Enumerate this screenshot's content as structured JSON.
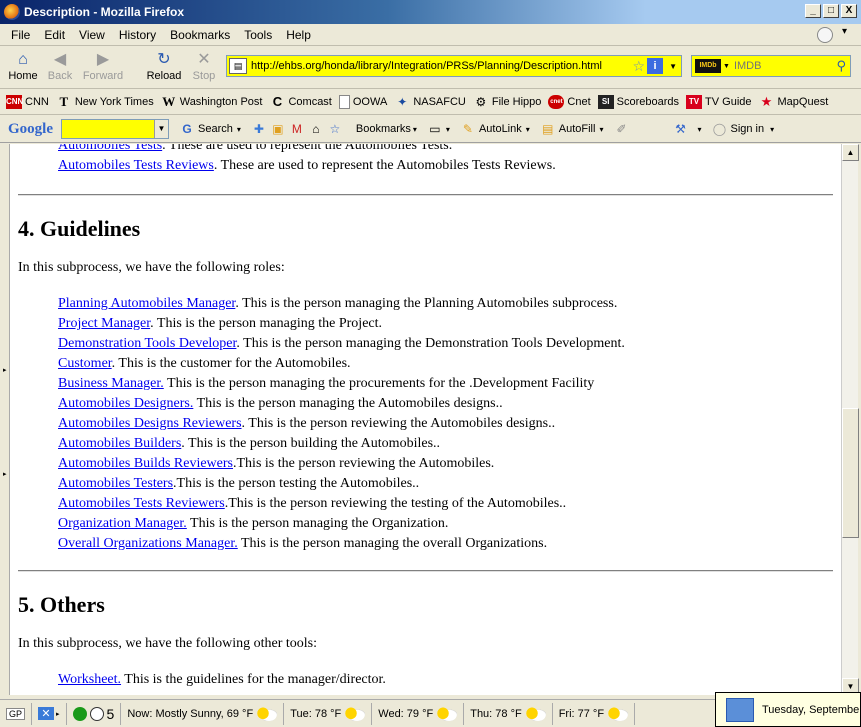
{
  "window": {
    "title": "Description - Mozilla Firefox",
    "btn_min": "_",
    "btn_max": "□",
    "btn_close": "X"
  },
  "menu": [
    "File",
    "Edit",
    "View",
    "History",
    "Bookmarks",
    "Tools",
    "Help"
  ],
  "nav": {
    "home": "Home",
    "back": "Back",
    "forward": "Forward",
    "reload": "Reload",
    "stop": "Stop",
    "url": "http://ehbs.org/honda/library/Integration/PRSs/Planning/Description.html",
    "search_engine": "IMDb",
    "search_placeholder": "IMDB"
  },
  "bookmarks": [
    "CNN",
    "New York Times",
    "Washington Post",
    "Comcast",
    "OOWA",
    "NASAFCU",
    "File Hippo",
    "Cnet",
    "Scoreboards",
    "TV Guide",
    "MapQuest"
  ],
  "google_toolbar": {
    "logo": "Google",
    "search": "Search",
    "bookmarks": "Bookmarks",
    "autolink": "AutoLink",
    "autofill": "AutoFill",
    "signin": "Sign in"
  },
  "content": {
    "top_lines": [
      {
        "link": "Automobiles Tests",
        "text": ". These are used to represent the Automobiles Tests."
      },
      {
        "link": "Automobiles Tests Reviews",
        "text": ". These are used to represent the Automobiles Tests Reviews."
      }
    ],
    "section4": {
      "heading": "4. Guidelines",
      "intro": "In this subprocess, we have the following roles:",
      "roles": [
        {
          "link": "Planning Automobiles Manager",
          "text": ". This is the person managing the Planning Automobiles subprocess."
        },
        {
          "link": "Project Manager",
          "text": ". This is the person managing the Project."
        },
        {
          "link": "Demonstration Tools Developer",
          "text": ". This is the person managing the Demonstration Tools Development."
        },
        {
          "link": "Customer",
          "text": ". This is the customer for the Automobiles."
        },
        {
          "link": "Business Manager.",
          "text": " This is the person managing the procurements for the .Development Facility"
        },
        {
          "link": "Automobiles Designers.",
          "text": " This is the person managing the Automobiles designs.."
        },
        {
          "link": "Automobiles Designs Reviewers",
          "text": ". This is the person reviewing the Automobiles designs.."
        },
        {
          "link": "Automobiles Builders",
          "text": ". This is the person building the Automobiles.."
        },
        {
          "link": "Automobiles Builds Reviewers",
          "text": ".This is the person reviewing the Automobiles."
        },
        {
          "link": "Automobiles Testers",
          "text": ".This is the person testing the Automobiles.."
        },
        {
          "link": "Automobiles Tests Reviewers",
          "text": ".This is the person reviewing the testing of the Automobiles.."
        },
        {
          "link": "Organization Manager.",
          "text": " This is the person managing the Organization."
        },
        {
          "link": "Overall Organizations Manager.",
          "text": " This is the person managing the overall Organizations."
        }
      ]
    },
    "section5": {
      "heading": "5. Others",
      "intro": "In this subprocess, we have the following other tools:",
      "tools": [
        {
          "link": "Worksheet.",
          "text": " This is the guidelines for the manager/director."
        }
      ]
    }
  },
  "statusbar": {
    "gp": "GP",
    "count": "5",
    "weather": [
      "Now: Mostly Sunny, 69 °F",
      "Tue: 78 °F",
      "Wed: 79 °F",
      "Thu: 78 °F",
      "Fri: 77 °F"
    ],
    "date_tooltip": "Tuesday, Septembe"
  }
}
